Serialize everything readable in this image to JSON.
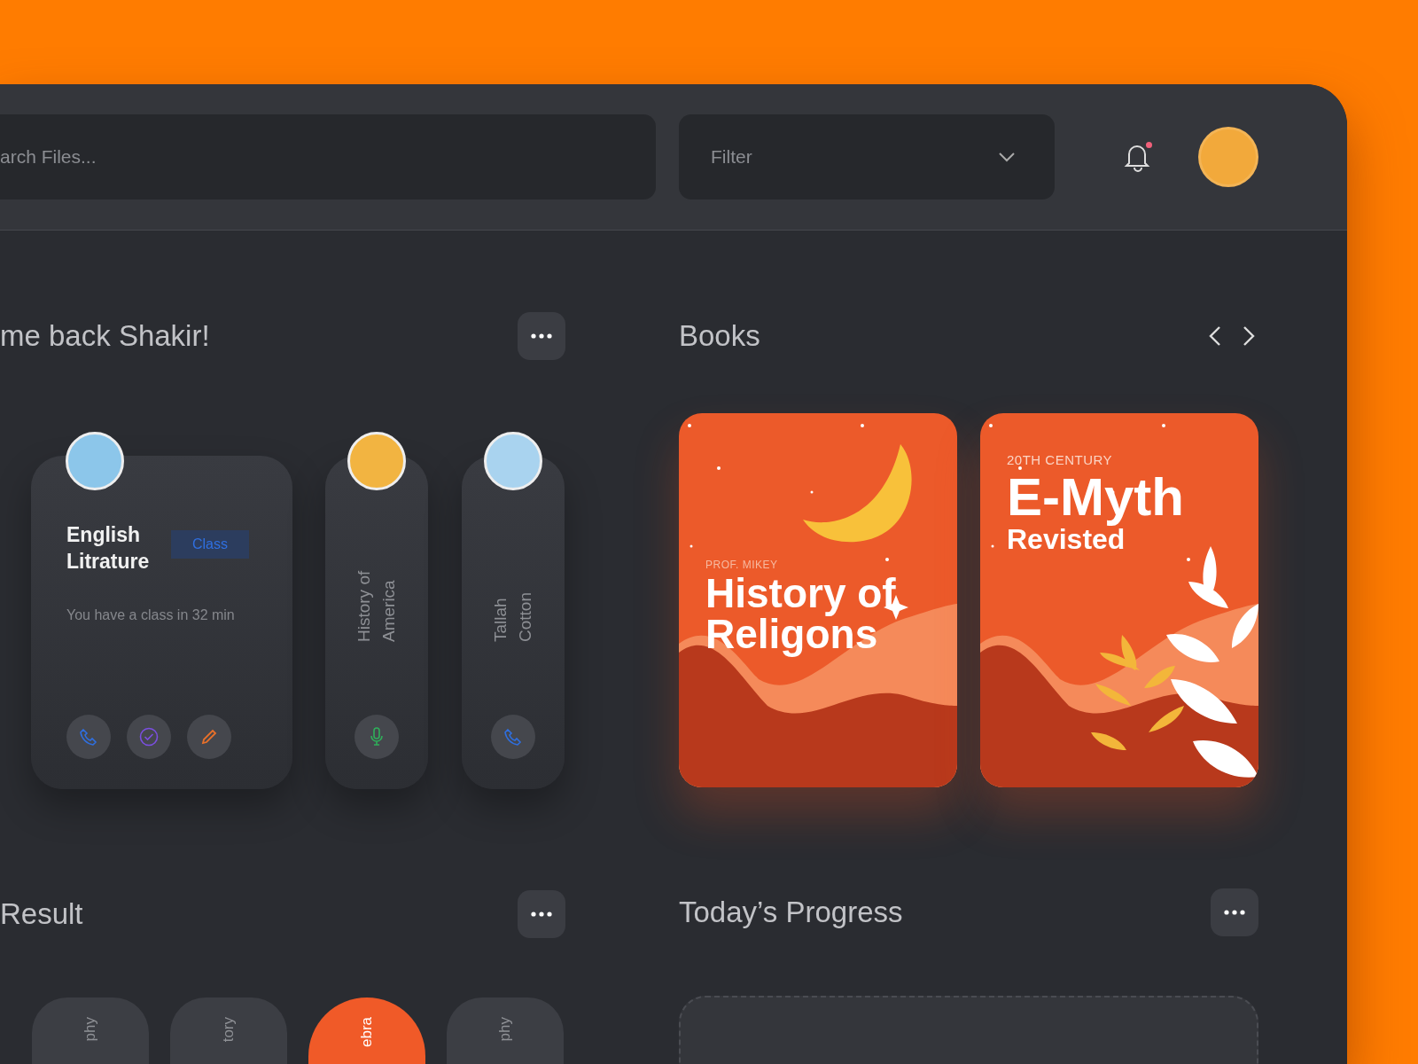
{
  "search": {
    "placeholder": "arch Files..."
  },
  "filter": {
    "placeholder": "Filter"
  },
  "notifications": {
    "unread": true
  },
  "welcome": {
    "title": "me back Shakir!"
  },
  "classes": [
    {
      "kind": "wide",
      "title": "English Litrature",
      "tag": "Class",
      "subtitle": "You have a class in 32 min",
      "actions": [
        {
          "kind": "phone",
          "color": "#2f6fe0"
        },
        {
          "kind": "check",
          "color": "#7b4fe0"
        },
        {
          "kind": "pencil",
          "color": "#e8702a"
        }
      ]
    },
    {
      "kind": "narrow",
      "title": "History of America",
      "actions": [
        {
          "kind": "mic",
          "color": "#2fae5a"
        }
      ]
    },
    {
      "kind": "narrow",
      "title": "Tallah Cotton",
      "actions": [
        {
          "kind": "phone",
          "color": "#2f6fe0"
        }
      ]
    }
  ],
  "books": {
    "title": "Books",
    "items": [
      {
        "kind": "moon",
        "kicker": "PROF. MIKEY",
        "title": "History of Religons"
      },
      {
        "kind": "leaves",
        "kicker": "20TH CENTURY",
        "title": "E-Myth",
        "subtitle": "Revisted"
      }
    ]
  },
  "result": {
    "title": "Result",
    "subjects": [
      {
        "label": "phy",
        "selected": false
      },
      {
        "label": "tory",
        "selected": false
      },
      {
        "label": "ebra",
        "selected": true
      },
      {
        "label": "phy",
        "selected": false
      }
    ]
  },
  "progress": {
    "title": "Today’s Progress"
  }
}
